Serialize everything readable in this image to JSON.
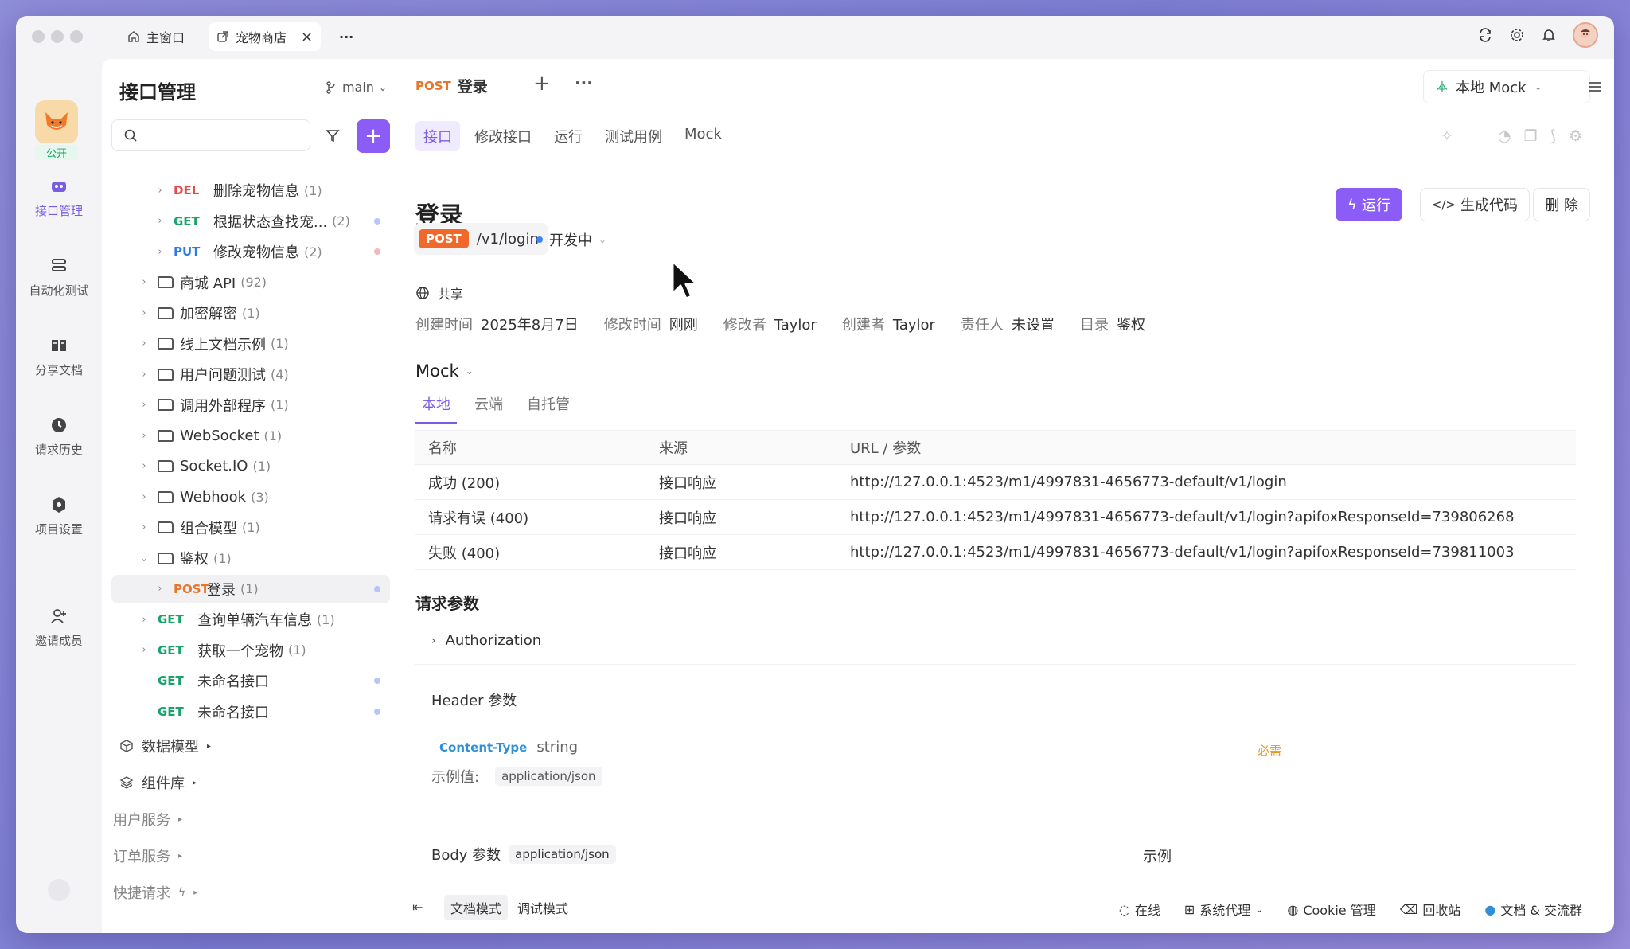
{
  "titlebar": {
    "tabs": [
      {
        "label": "主窗口"
      },
      {
        "label": "宠物商店"
      }
    ],
    "more": "···"
  },
  "leftnav": {
    "visibility": "公开",
    "items": [
      {
        "label": "接口管理",
        "icon": "api-icon"
      },
      {
        "label": "自动化测试",
        "icon": "automation-icon"
      },
      {
        "label": "分享文档",
        "icon": "book-icon"
      },
      {
        "label": "请求历史",
        "icon": "clock-icon"
      },
      {
        "label": "项目设置",
        "icon": "settings-icon"
      },
      {
        "label": "邀请成员",
        "icon": "add-user-icon"
      }
    ]
  },
  "sidebar": {
    "title": "接口管理",
    "branch": "main",
    "tree": [
      {
        "method": "DEL",
        "name": "删除宠物信息",
        "count": "(1)",
        "level": 2,
        "dot": ""
      },
      {
        "method": "GET",
        "name": "根据状态查找宠...",
        "count": "(2)",
        "level": 2,
        "dot": "#b8c6f5"
      },
      {
        "method": "PUT",
        "name": "修改宠物信息",
        "count": "(2)",
        "level": 2,
        "dot": "#f5b8b8"
      },
      {
        "folder": true,
        "name": "商城 API",
        "count": "(92)"
      },
      {
        "folder": true,
        "name": "加密解密",
        "count": "(1)"
      },
      {
        "folder": true,
        "name": "线上文档示例",
        "count": "(1)"
      },
      {
        "folder": true,
        "name": "用户问题测试",
        "count": "(4)"
      },
      {
        "folder": true,
        "name": "调用外部程序",
        "count": "(1)"
      },
      {
        "folder": true,
        "name": "WebSocket",
        "count": "(1)"
      },
      {
        "folder": true,
        "name": "Socket.IO",
        "count": "(1)"
      },
      {
        "folder": true,
        "name": "Webhook",
        "count": "(3)"
      },
      {
        "folder": true,
        "name": "组合模型",
        "count": "(1)"
      },
      {
        "folder": true,
        "name": "鉴权",
        "count": "(1)",
        "open": true
      },
      {
        "method": "POST",
        "name": "登录",
        "count": "(1)",
        "level": 2,
        "selected": true,
        "dot": "#b8c6f5"
      },
      {
        "method": "GET",
        "name": "查询单辆汽车信息",
        "count": "(1)",
        "level": 1
      },
      {
        "method": "GET",
        "name": "获取一个宠物",
        "count": "(1)",
        "level": 1
      },
      {
        "method": "GET",
        "name": "未命名接口",
        "count": "",
        "level": 1,
        "noChev": true,
        "dot": "#b8c6f5"
      },
      {
        "method": "GET",
        "name": "未命名接口",
        "count": "",
        "level": 1,
        "noChev": true,
        "dot": "#b8c6f5"
      }
    ],
    "sections": [
      {
        "label": "数据模型"
      },
      {
        "label": "组件库"
      },
      {
        "label": "用户服务"
      },
      {
        "label": "订单服务"
      },
      {
        "label": "快捷请求"
      }
    ]
  },
  "main": {
    "tab_method": "POST",
    "tab_title": "登录",
    "mock_select": "本地 Mock",
    "subtabs": [
      "接口",
      "修改接口",
      "运行",
      "测试用例",
      "Mock"
    ],
    "title": "登录",
    "buttons": {
      "run": "运行",
      "gencode": "生成代码",
      "delete": "删 除"
    },
    "method": "POST",
    "path": "/v1/login",
    "status": "开发中",
    "shared": "共享",
    "meta": [
      {
        "k": "创建时间",
        "v": "2025年8月7日"
      },
      {
        "k": "修改时间",
        "v": "刚刚"
      },
      {
        "k": "修改者",
        "v": "Taylor"
      },
      {
        "k": "创建者",
        "v": "Taylor"
      },
      {
        "k": "责任人",
        "v": "未设置"
      },
      {
        "k": "目录",
        "v": "鉴权"
      }
    ],
    "mock": {
      "heading": "Mock",
      "tabs": [
        "本地",
        "云端",
        "自托管"
      ],
      "columns": [
        "名称",
        "来源",
        "URL / 参数"
      ],
      "rows": [
        {
          "name": "成功 (200)",
          "source": "接口响应",
          "url": "http://127.0.0.1:4523/m1/4997831-4656773-default/v1/login"
        },
        {
          "name": "请求有误 (400)",
          "source": "接口响应",
          "url": "http://127.0.0.1:4523/m1/4997831-4656773-default/v1/login?apifoxResponseId=739806268"
        },
        {
          "name": "失败 (400)",
          "source": "接口响应",
          "url": "http://127.0.0.1:4523/m1/4997831-4656773-default/v1/login?apifoxResponseId=739811003"
        }
      ]
    },
    "params": {
      "heading": "请求参数",
      "authorization": "Authorization",
      "header_heading": "Header 参数",
      "header_name": "Content-Type",
      "header_type": "string",
      "required": "必需",
      "example_label": "示例值:",
      "example_value": "application/json",
      "body_heading": "Body 参数",
      "body_type": "application/json",
      "example_heading": "示例"
    }
  },
  "footer": {
    "modes": [
      "文档模式",
      "调试模式"
    ],
    "online": "在线",
    "proxy": "系统代理",
    "cookie": "Cookie 管理",
    "recycle": "回收站",
    "docs": "文档 & 交流群"
  },
  "colors": {
    "accent": "#8b5cf6",
    "post": "#f0692a",
    "get": "#17a36a",
    "del": "#e44a4a",
    "put": "#2f7ae5"
  }
}
